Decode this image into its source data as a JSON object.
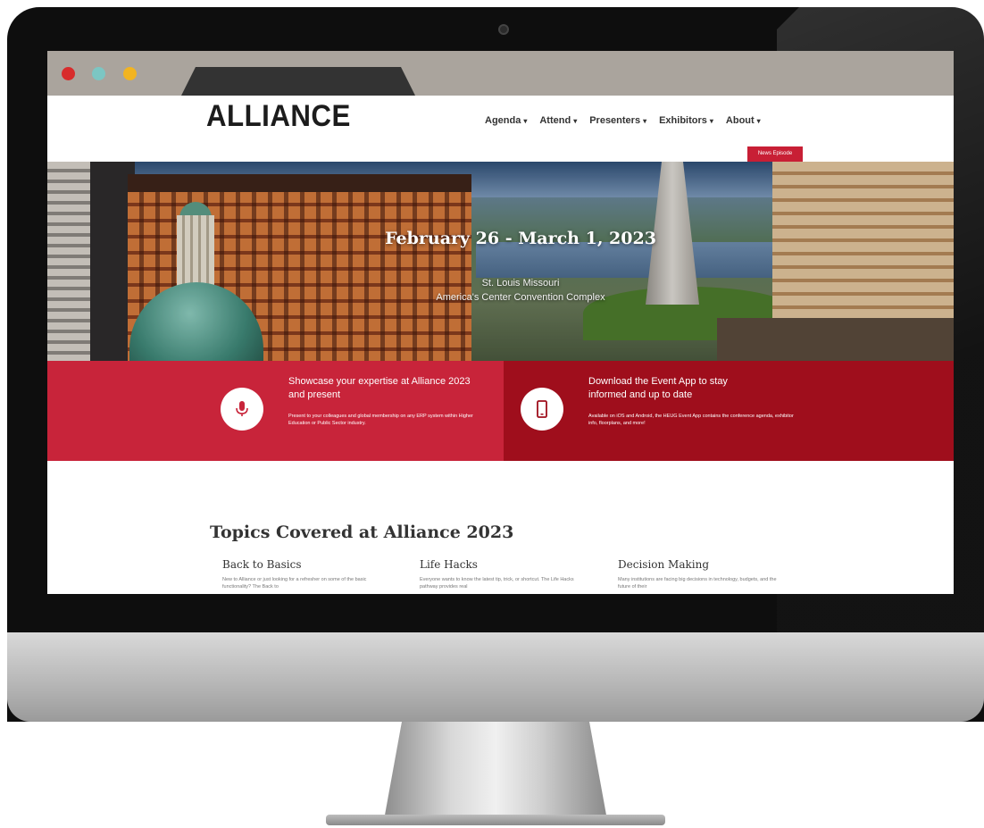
{
  "browser": {
    "dots": [
      "red",
      "teal",
      "yellow"
    ],
    "dot_colors": {
      "red": "#d82c2c",
      "teal": "#7cc6c3",
      "yellow": "#f2b421"
    }
  },
  "header": {
    "logo": "ALLIANCE",
    "nav": [
      {
        "label": "Agenda",
        "caret": "▾"
      },
      {
        "label": "Attend",
        "caret": "▾"
      },
      {
        "label": "Presenters",
        "caret": "▾"
      },
      {
        "label": "Exhibitors",
        "caret": "▾"
      },
      {
        "label": "About",
        "caret": "▾"
      }
    ],
    "news_button": "News Episode"
  },
  "hero": {
    "date": "February 26 - March 1, 2023",
    "city": "St. Louis Missouri",
    "venue": "America's Center Convention Complex"
  },
  "cta": {
    "present": {
      "icon": "microphone-icon",
      "title": "Showcase your expertise at Alliance 2023 and present",
      "body": "Present to your colleagues and global membership on any ERP system within Higher Education or Public Sector industry."
    },
    "app": {
      "icon": "mobile-phone-icon",
      "title": "Download the Event App to stay informed and up to date",
      "body": "Available on iOS and Android, the HEUG Event App contains the conference agenda, exhibitor info, floorplans, and more!"
    }
  },
  "topics": {
    "title": "Topics Covered at Alliance 2023",
    "items": [
      {
        "title": "Back to Basics",
        "text": "New to Alliance or just looking for a refresher on some of the basic functionality? The Back to"
      },
      {
        "title": "Life Hacks",
        "text": "Everyone wants to know the latest tip, trick, or shortcut. The Life Hacks pathway provides real"
      },
      {
        "title": "Decision Making",
        "text": "Many institutions are facing big decisions in technology, budgets, and the future of their"
      }
    ]
  },
  "colors": {
    "cta_left": "#c8243a",
    "cta_right": "#9f0e1c",
    "browser_bar": "#aaa49d"
  }
}
